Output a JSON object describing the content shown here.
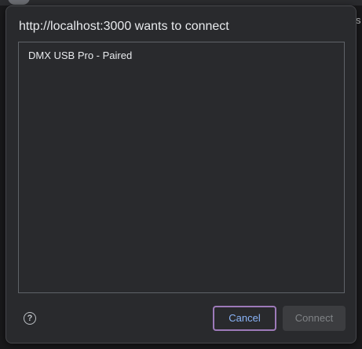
{
  "page": {
    "edge_text": "s"
  },
  "dialog": {
    "title": "http://localhost:3000 wants to connect",
    "devices": [
      {
        "label": "DMX USB Pro - Paired"
      }
    ],
    "help_icon": "help-circle-icon",
    "help_glyph": "?",
    "cancel_label": "Cancel",
    "connect_label": "Connect",
    "connect_disabled": true
  },
  "colors": {
    "dialog_bg": "#292a2d",
    "accent_text": "#8ab4f8",
    "focus_ring": "#9d7ab9",
    "disabled_text": "#808386"
  }
}
